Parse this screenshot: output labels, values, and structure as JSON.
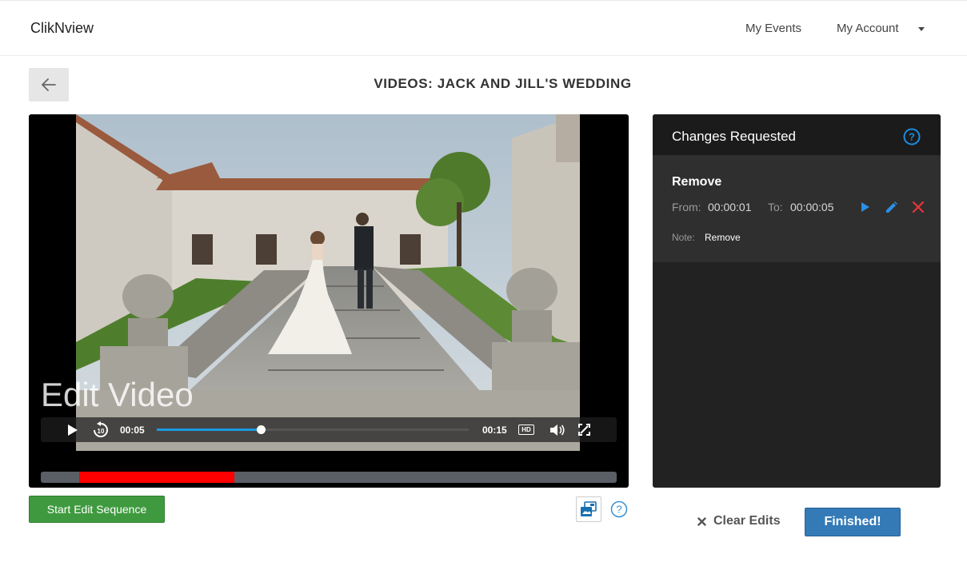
{
  "nav": {
    "brand": "ClikNview",
    "my_events": "My Events",
    "my_account": "My Account"
  },
  "page": {
    "title": "VIDEOS: JACK AND JILL'S WEDDING"
  },
  "player": {
    "overlay_label": "Edit Video",
    "current_time": "00:05",
    "duration": "00:15",
    "progress_fraction": 0.333,
    "quality_badge": "HD",
    "edit_region_start_fraction": 0.067,
    "edit_region_end_fraction": 0.333
  },
  "actions": {
    "start_edit": "Start Edit Sequence",
    "clear_edits": "Clear Edits",
    "finished": "Finished!"
  },
  "changes": {
    "title": "Changes Requested",
    "items": [
      {
        "type": "Remove",
        "from_label": "From:",
        "from": "00:00:01",
        "to_label": "To:",
        "to": "00:00:05",
        "note_label": "Note:",
        "note": "Remove"
      }
    ]
  },
  "colors": {
    "accent": "#337ab7",
    "start_button": "#3f9a3f",
    "edit_region": "#ff0000",
    "progress": "#1a9be0",
    "help_icon": "#1a8de0"
  },
  "icons": {
    "back": "arrow-left-icon",
    "play": "play-icon",
    "rewind": "rewind-10-icon",
    "volume": "volume-icon",
    "fullscreen": "fullscreen-icon",
    "snapshot": "snapshot-icon",
    "help": "help-circle-icon",
    "card_play": "play-icon",
    "card_edit": "pencil-icon",
    "card_delete": "close-icon",
    "clear": "close-icon"
  }
}
